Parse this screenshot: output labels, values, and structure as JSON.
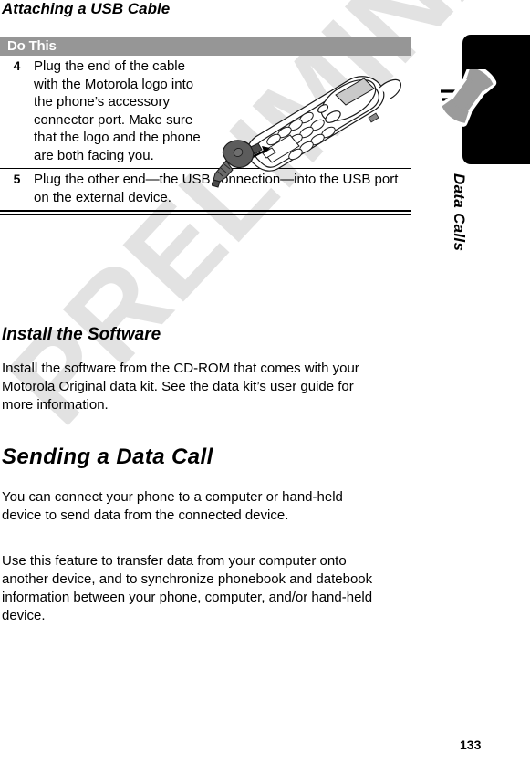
{
  "document": {
    "page_title": "Attaching a USB Cable",
    "page_number": "133",
    "watermark": "PRELIMINARY"
  },
  "table": {
    "header": "Do This",
    "header_bg": "#969696",
    "rows": [
      {
        "number": "4",
        "text": "Plug the end of the cable with the Motorola logo into the phone’s accessory connector port. Make sure that the logo and the phone are both facing you.",
        "illustration": "phone-with-usb-cable-illustration"
      },
      {
        "number": "5",
        "text": "Plug the other end—the USB connection—into the USB port on the external device."
      }
    ]
  },
  "sections": [
    {
      "id": "install-the-software",
      "heading": "Install the Software",
      "level": "h2",
      "paragraphs": [
        "Install the software from the CD-ROM that comes with your Motorola Original data kit. See the data kit’s user guide for more information."
      ]
    },
    {
      "id": "sending-a-data-call",
      "heading": "Sending a Data Call",
      "level": "h1",
      "paragraphs": [
        "You can connect your phone to a computer or hand-held device to send data from the connected device.",
        "Use this feature to transfer data from your computer onto another device, and to synchronize phonebook and datebook information between your phone, computer, and/or hand-held device."
      ]
    }
  ],
  "side_tab": {
    "label": "Data Calls",
    "icon": "telephone-handset-icon",
    "background": "#000000",
    "icon_color": "#9b9b9b"
  }
}
